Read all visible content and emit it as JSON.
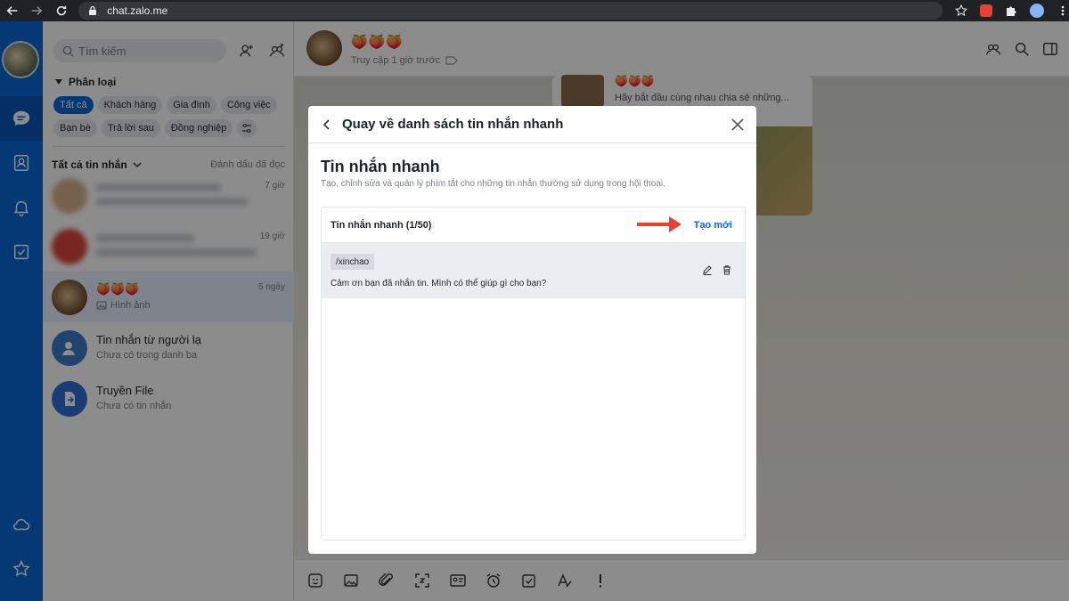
{
  "browser": {
    "url": "chat.zalo.me"
  },
  "sidebar": {
    "search_placeholder": "Tìm kiếm",
    "filter_title": "Phân loại",
    "chips": [
      "Tất cả",
      "Khách hàng",
      "Gia đình",
      "Công việc",
      "Bạn bè",
      "Trả lời sau",
      "Đồng nghiệp"
    ],
    "list_title": "Tất cả tin nhắn",
    "mark_read": "Đánh dấu đã đọc",
    "conversations": [
      {
        "name": "",
        "sub": "",
        "time": "7 giờ"
      },
      {
        "name": "",
        "sub": "",
        "time": "19 giờ"
      },
      {
        "name": "🍑🍑🍑",
        "sub": "Hình ảnh",
        "time": "5 ngày"
      },
      {
        "name": "Tin nhắn từ người lạ",
        "sub": "Chưa có trong danh ba",
        "time": ""
      },
      {
        "name": "Truyền File",
        "sub": "Chưa có tin nhắn",
        "time": ""
      }
    ]
  },
  "chat": {
    "name": "🍑🍑🍑",
    "status": "Truy cập 1 giờ trước",
    "card_title": "🍑🍑🍑",
    "card_text": "Hãy bắt đầu cùng nhau chia sẻ những..."
  },
  "modal": {
    "back_label": "Quay về danh sách tin nhắn nhanh",
    "heading": "Tin nhắn nhanh",
    "description": "Tạo, chỉnh sửa và quản lý phím tắt cho những tin nhắn thường sử dụng trong hội thoại.",
    "count_label": "Tin nhắn nhanh (1/50)",
    "new_label": "Tạo mới",
    "items": [
      {
        "shortcut": "/xinchao",
        "text": "Cảm ơn bạn đã nhắn tin. Mình có thể giúp gì cho bạn?"
      }
    ]
  },
  "colors": {
    "accent": "#0a68d6",
    "annotation_arrow": "#e8412f"
  }
}
